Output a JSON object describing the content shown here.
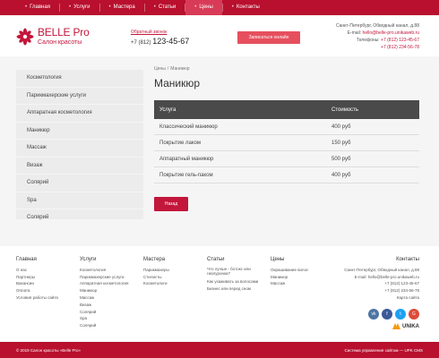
{
  "nav": {
    "items": [
      {
        "label": "Главная"
      },
      {
        "label": "Услуги"
      },
      {
        "label": "Мастера"
      },
      {
        "label": "Статьи"
      },
      {
        "label": "Цены"
      },
      {
        "label": "Контакты"
      }
    ],
    "active_index": 4
  },
  "header": {
    "logo_name": "BELLE Pro",
    "logo_sub": "Салон красоты",
    "callback": "Обратный звонок",
    "phone_code": "+7 (812)",
    "phone_num": "123-45-67",
    "cta": "Записаться онлайн",
    "address": "Санкт-Петербург, Обводный канал, д.88",
    "email_label": "E-mail:",
    "email": "hello@belle-pro.unikaweb.ru",
    "phones_label": "Телефоны:",
    "phone1": "+7 (812) 123-45-67",
    "phone2": "+7 (812) 234-56-78"
  },
  "sidebar": {
    "items": [
      {
        "label": "Косметология"
      },
      {
        "label": "Парикмахерские услуги"
      },
      {
        "label": "Аппаратная косметология"
      },
      {
        "label": "Маникюр"
      },
      {
        "label": "Массаж"
      },
      {
        "label": "Визаж"
      },
      {
        "label": "Солярий"
      },
      {
        "label": "Spa"
      },
      {
        "label": "Солярий"
      }
    ]
  },
  "content": {
    "breadcrumb": [
      "Цены",
      "Маникюр"
    ],
    "breadcrumb_sep": "/",
    "title": "Маникюр",
    "table": {
      "headers": [
        "Услуга",
        "Стоимость"
      ],
      "rows": [
        [
          "Классический маникюр",
          "400 руб"
        ],
        [
          "Покрытие лаком",
          "150 руб"
        ],
        [
          "Аппаратный маникюр",
          "500 руб"
        ],
        [
          "Покрытие гель-паком",
          "400 руб"
        ]
      ]
    },
    "back": "Назад"
  },
  "footer": {
    "cols": [
      {
        "head": "Главная",
        "items": [
          "О нас",
          "Партнеры",
          "Вакансии",
          "Оплата",
          "Условия работы сайта"
        ]
      },
      {
        "head": "Услуги",
        "items": [
          "Косметология",
          "Парикмахерские услуги",
          "Аппаратная косметология",
          "Маникюр",
          "Массаж",
          "Визаж",
          "Солярий",
          "Spa",
          "Солярий"
        ]
      },
      {
        "head": "Мастера",
        "items": [
          "Парикмахеры",
          "Стилисты",
          "Косметологи"
        ]
      },
      {
        "head": "Статьи",
        "items": [
          "Что лучше - ботокс или гиалуронка?",
          "Как ухаживать за волосами",
          "Бизнес или перед сном"
        ]
      },
      {
        "head": "Цены",
        "items": [
          "Окрашивание волос",
          "Маникюр",
          "Массаж"
        ]
      }
    ],
    "contacts": {
      "head": "Контакты",
      "address": "Санкт-Петербург, Обводный канал, д.88",
      "email": "E-mail: hello@belle-pro.unikaweb.ru",
      "phone1": "+7 (812) 123-45-67",
      "phone2": "+7 (812) 234-56-78",
      "map": "Карта сайта"
    },
    "socials": [
      {
        "name": "vk-icon",
        "glyph": "vk",
        "color": "#4c75a3"
      },
      {
        "name": "facebook-icon",
        "glyph": "f",
        "color": "#3b5998"
      },
      {
        "name": "twitter-icon",
        "glyph": "t",
        "color": "#1da1f2"
      },
      {
        "name": "google-icon",
        "glyph": "G",
        "color": "#dd4b39"
      }
    ],
    "brand": "UNIKA"
  },
  "bottom": {
    "copyright": "© 2019 Салон красоты «Belle Pro»",
    "cms": "Система управления сайтом — UPK CMS"
  },
  "colors": {
    "brand": "#b8102e",
    "accent": "#c3163b",
    "table_header": "#4a4a4a"
  }
}
